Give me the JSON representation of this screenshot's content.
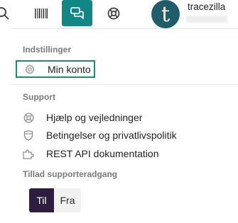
{
  "topbar": {
    "icons": [
      "search-icon",
      "barcode-icon",
      "chat-icon",
      "lifebuoy-icon"
    ],
    "active_icon": "chat-icon",
    "accent_color": "#128585",
    "avatar_letter": "t",
    "username": "tracezilla"
  },
  "menu": {
    "settings": {
      "label": "Indstillinger",
      "items": [
        {
          "label": "Min konto",
          "icon": "gear-icon"
        }
      ]
    },
    "support": {
      "label": "Support",
      "items": [
        {
          "label": "Hjælp og vejledninger",
          "icon": "lifebuoy-icon"
        },
        {
          "label": "Betingelser og privatlivspolitik",
          "icon": "shield-icon"
        },
        {
          "label": "REST API dokumentation",
          "icon": "puzzle-icon"
        }
      ]
    },
    "support_access": {
      "label": "Tillad supporteradgang",
      "options": [
        "Til",
        "Fra"
      ],
      "selected": "Til",
      "selected_color": "#2d1d3f"
    }
  }
}
